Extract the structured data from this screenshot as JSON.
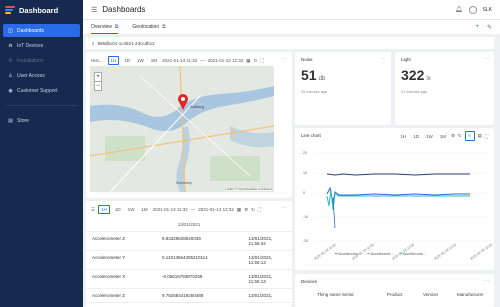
{
  "sidebar": {
    "app_title": "Dashboard",
    "items": [
      {
        "label": "Dashboards",
        "icon": "dashboard-icon"
      },
      {
        "label": "IoT Devices",
        "icon": "device-icon"
      },
      {
        "label": "Installations",
        "icon": "installation-icon"
      },
      {
        "label": "User Access",
        "icon": "user-icon"
      },
      {
        "label": "Customer Support",
        "icon": "support-icon"
      },
      {
        "label": "Store",
        "icon": "store-icon"
      }
    ]
  },
  "header": {
    "title": "Dashboards",
    "user": "SLK"
  },
  "tabs": [
    {
      "label": "Overview"
    },
    {
      "label": "Geolocation"
    }
  ],
  "entity_id": "995dbc01-1c4521-23ccdb12",
  "history_card": {
    "title": "Hist...",
    "buttons": [
      "1H",
      "1D",
      "1W",
      "1M"
    ],
    "range_from": "2021-01-13 11:32",
    "range_sep": "—",
    "range_to": "2021-01-13 12:32",
    "attribution": "Leaflet | © OpenStreetMap contributors",
    "map_labels": {
      "city": "Aalborg",
      "town": "Svenstrup"
    }
  },
  "noise_card": {
    "title": "Noise",
    "value": "51",
    "unit": "db",
    "ago": "26 minutes ago"
  },
  "light_card": {
    "title": "Light",
    "value": "322",
    "unit": "lx",
    "ago": "21 minutes ago"
  },
  "table_card": {
    "buttons": [
      "1H",
      "1D",
      "1W",
      "1M"
    ],
    "range_from": "2021-01-13 11:32",
    "range_sep": "—",
    "range_to": "2021-01-13 12:32",
    "date": "13/01/2021",
    "rows": [
      {
        "name": "Accelerometer Z",
        "value": "9.83328628540039",
        "time": "13/01/2021, 11:56:34"
      },
      {
        "name": "Accelerometer Y",
        "value": "0.11013664305210114",
        "time": "13/01/2021, 11:56:13"
      },
      {
        "name": "Accelerometer X",
        "value": "-0.05616793870259",
        "time": "13/01/2021, 11:56:13"
      },
      {
        "name": "Accelerometer Z",
        "value": "9.792584419250488",
        "time": "13/01/2021,"
      }
    ]
  },
  "line_chart": {
    "title": "Line chart",
    "buttons": [
      "1H",
      "1D",
      "1W",
      "1M"
    ],
    "y_ticks": [
      "20",
      "10",
      "0",
      "-10",
      "-20"
    ],
    "legend": [
      "Accelerome...",
      "Accelerome...",
      "Accelerome..."
    ],
    "x_ticks": [
      "2021-01-13 11:42",
      "2021-01-13 11:50",
      "2021-01-13 12:00",
      "2021-01-13 12:10",
      "2021-01-13 12:20"
    ]
  },
  "devices_card": {
    "title": "Devices",
    "columns": [
      "Thing name",
      "Serial",
      "Product",
      "Version",
      "Manufacturer"
    ]
  },
  "colors": {
    "sidebar": "#152a4e",
    "accent": "#2a6be8",
    "marker": "#e0262b"
  }
}
